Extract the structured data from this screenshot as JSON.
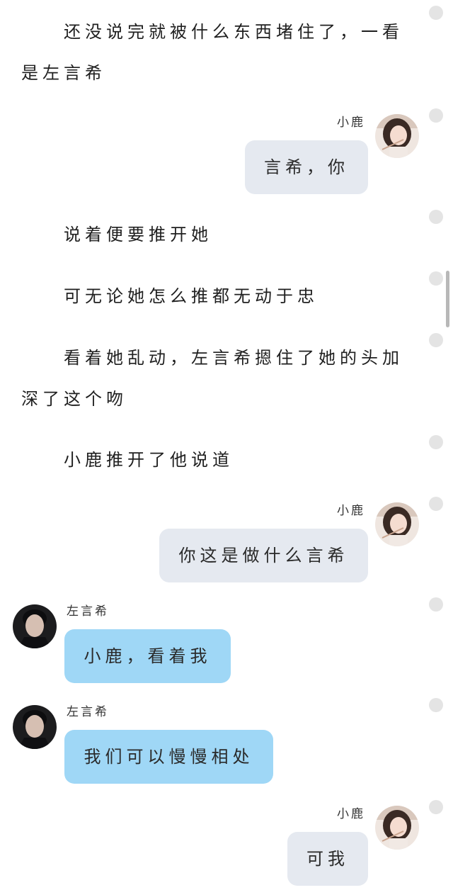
{
  "narrations": [
    "还没说完就被什么东西堵住了，一看是左言希",
    "说着便要推开她",
    "可无论她怎么推都无动于忠",
    "看着她乱动，左言希摁住了她的头加深了这个吻",
    "小鹿推开了他说道"
  ],
  "messages": [
    {
      "sender": "小鹿",
      "side": "right",
      "text": "言希，你"
    },
    {
      "sender": "小鹿",
      "side": "right",
      "text": "你这是做什么言希"
    },
    {
      "sender": "左言希",
      "side": "left",
      "text": "小鹿，看着我"
    },
    {
      "sender": "左言希",
      "side": "left",
      "text": "我们可以慢慢相处"
    },
    {
      "sender": "小鹿",
      "side": "right",
      "text": "可我"
    }
  ],
  "colors": {
    "right_bubble": "#e5e9f0",
    "left_bubble": "#9fd7f6",
    "background": "#ffffff",
    "side_dot": "#e4e4e4"
  },
  "icons": {
    "xiaolu_avatar": "avatar-icon",
    "zuoyanxi_avatar": "avatar-icon",
    "side_dot": "circle-icon"
  }
}
